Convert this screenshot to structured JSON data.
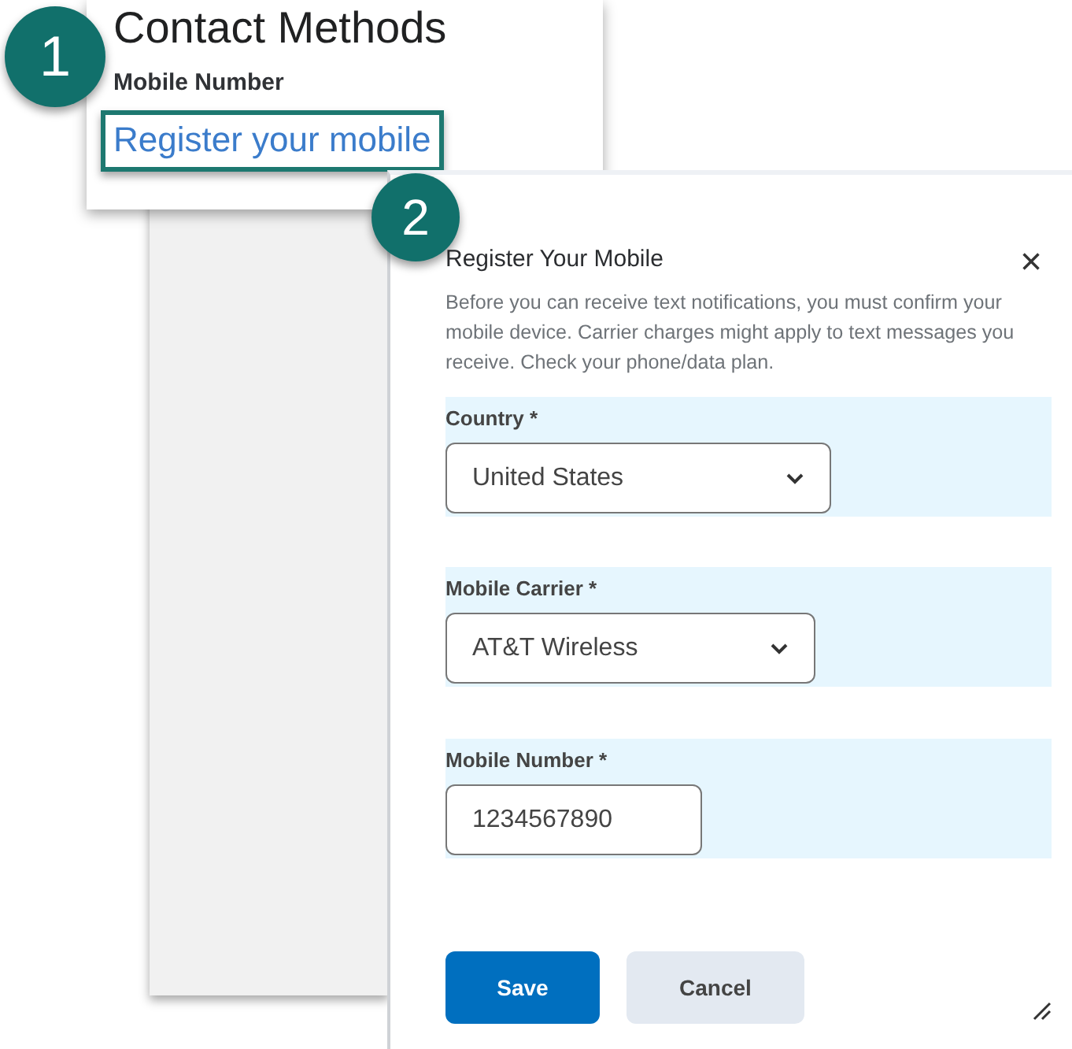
{
  "contact_card": {
    "title": "Contact Methods",
    "label": "Mobile Number",
    "link": "Register your mobile"
  },
  "callouts": [
    "1",
    "2"
  ],
  "dialog": {
    "title": "Register Your Mobile",
    "close": "×",
    "description": "Before you can receive text notifications, you must confirm your mobile device. Carrier charges might apply to text messages you receive. Check your phone/data plan.",
    "fields": [
      {
        "kind": "select",
        "label": "Country *",
        "value": "United States"
      },
      {
        "kind": "select",
        "label": "Mobile Carrier *",
        "value": "AT&T Wireless"
      },
      {
        "kind": "text",
        "label": "Mobile Number *",
        "value": "1234567890"
      }
    ],
    "buttons": [
      {
        "label": "Save",
        "primary": true
      },
      {
        "label": "Cancel",
        "primary": false
      }
    ]
  }
}
